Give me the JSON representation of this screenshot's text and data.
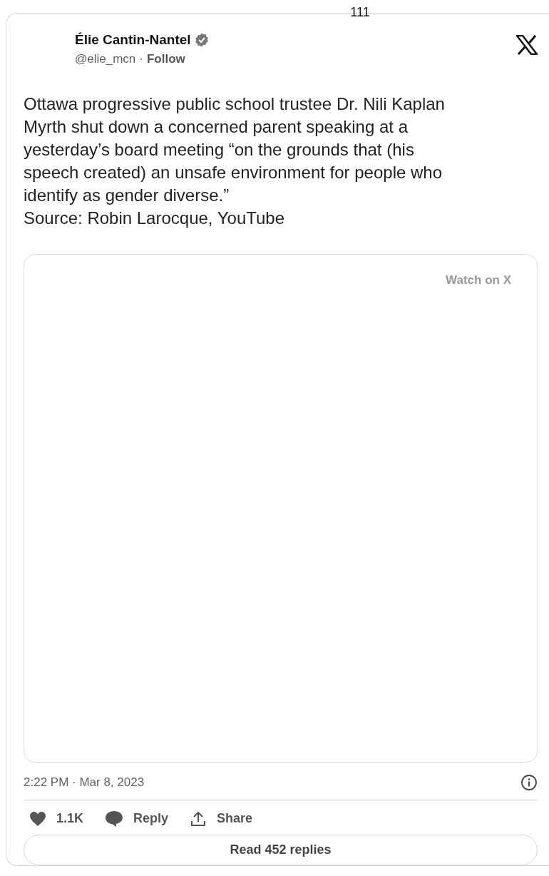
{
  "page_number": "111",
  "author": {
    "name": "Élie Cantin-Nantel",
    "verified": true,
    "handle": "@elie_mcn",
    "separator": "·",
    "follow": "Follow"
  },
  "text": "Ottawa progressive public school trustee Dr. Nili Kaplan\nMyrth shut down a concerned parent speaking at a\nyesterday’s board meeting “on the grounds that (his\nspeech created) an unsafe environment for people who\nidentify as gender diverse.”\nSource: Robin Larocque, YouTube",
  "media": {
    "watch_link": "Watch on X"
  },
  "timestamp": "2:22 PM · Mar 8, 2023",
  "actions": [
    {
      "kind": "like",
      "label": "1.1K"
    },
    {
      "kind": "reply",
      "label": "Reply"
    },
    {
      "kind": "share",
      "label": "Share"
    }
  ],
  "read_replies": "Read 452 replies"
}
